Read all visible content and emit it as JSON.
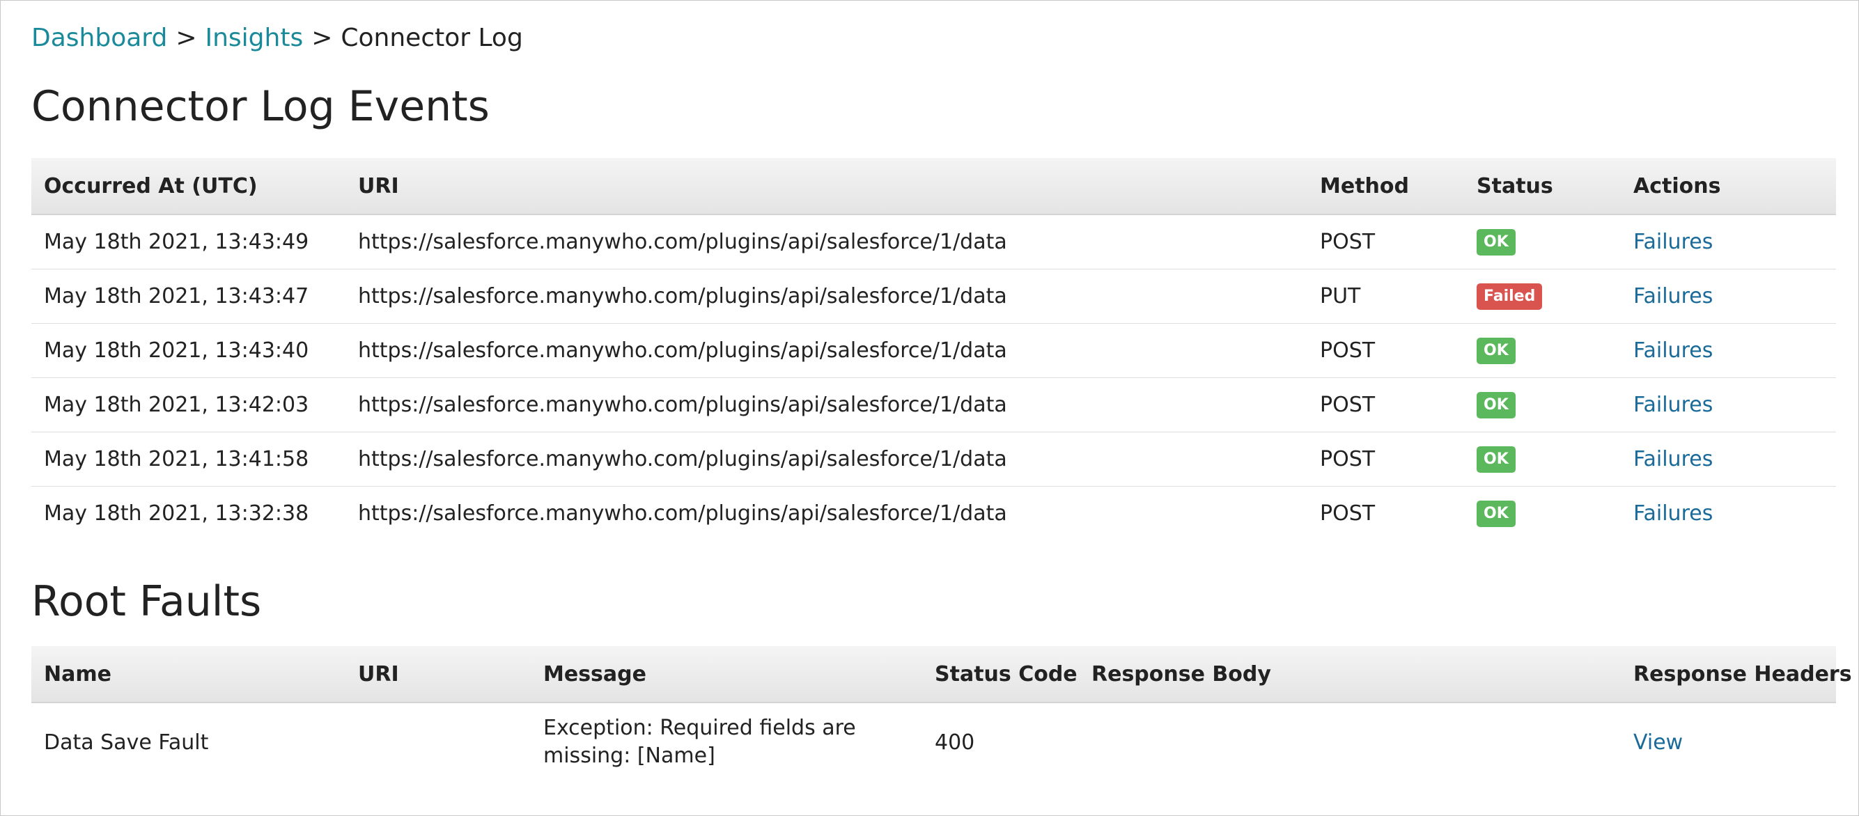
{
  "breadcrumb": {
    "items": [
      {
        "label": "Dashboard"
      },
      {
        "label": "Insights"
      },
      {
        "label": "Connector Log"
      }
    ],
    "separator": ">"
  },
  "events": {
    "title": "Connector Log Events",
    "columns": [
      "Occurred At (UTC)",
      "URI",
      "Method",
      "Status",
      "Actions"
    ],
    "rows": [
      {
        "occurred": "May 18th 2021, 13:43:49",
        "uri": "https://salesforce.manywho.com/plugins/api/salesforce/1/data",
        "method": "POST",
        "status": "OK",
        "action": "Failures"
      },
      {
        "occurred": "May 18th 2021, 13:43:47",
        "uri": "https://salesforce.manywho.com/plugins/api/salesforce/1/data",
        "method": "PUT",
        "status": "Failed",
        "action": "Failures"
      },
      {
        "occurred": "May 18th 2021, 13:43:40",
        "uri": "https://salesforce.manywho.com/plugins/api/salesforce/1/data",
        "method": "POST",
        "status": "OK",
        "action": "Failures"
      },
      {
        "occurred": "May 18th 2021, 13:42:03",
        "uri": "https://salesforce.manywho.com/plugins/api/salesforce/1/data",
        "method": "POST",
        "status": "OK",
        "action": "Failures"
      },
      {
        "occurred": "May 18th 2021, 13:41:58",
        "uri": "https://salesforce.manywho.com/plugins/api/salesforce/1/data",
        "method": "POST",
        "status": "OK",
        "action": "Failures"
      },
      {
        "occurred": "May 18th 2021, 13:32:38",
        "uri": "https://salesforce.manywho.com/plugins/api/salesforce/1/data",
        "method": "POST",
        "status": "OK",
        "action": "Failures"
      }
    ]
  },
  "faults": {
    "title": "Root Faults",
    "columns": [
      "Name",
      "URI",
      "Message",
      "Status Code",
      "Response Body",
      "Response Headers"
    ],
    "rows": [
      {
        "name": "Data Save Fault",
        "uri": "",
        "message": "Exception: Required fields are missing: [Name]",
        "status_code": "400",
        "response_body": "",
        "response_headers": "View"
      }
    ]
  },
  "colors": {
    "link": "#1a6a9a",
    "breadcrumb_link": "#1a8a9a",
    "ok": "#5cb85c",
    "failed": "#d9534f"
  }
}
